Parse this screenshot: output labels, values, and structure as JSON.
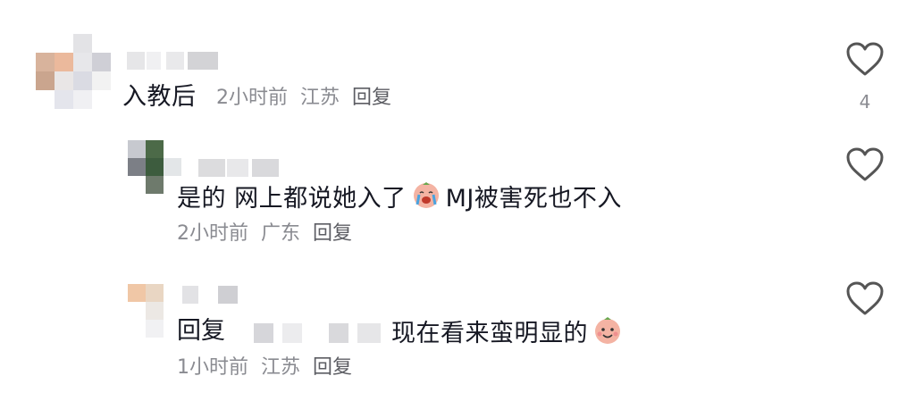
{
  "comments": [
    {
      "username": "",
      "text": "入教后",
      "time": "2小时前",
      "location": "江苏",
      "reply_label": "回复",
      "like_count": "4",
      "liked": false
    },
    {
      "username": "",
      "text_before_emoji": "是的 网上都说她入了",
      "emoji": "crying-face-emoji",
      "text_after_emoji": "MJ被害死也不入",
      "time": "2小时前",
      "location": "广东",
      "reply_label": "回复",
      "liked": false
    },
    {
      "username": "",
      "reply_prefix": "回复",
      "text": "现在看来蛮明显的",
      "emoji": "smiling-face-emoji",
      "time": "1小时前",
      "location": "江苏",
      "reply_label": "回复",
      "liked": false
    }
  ],
  "colors": {
    "meta": "#8a8b91",
    "text": "#161823",
    "icon": "#555555"
  }
}
